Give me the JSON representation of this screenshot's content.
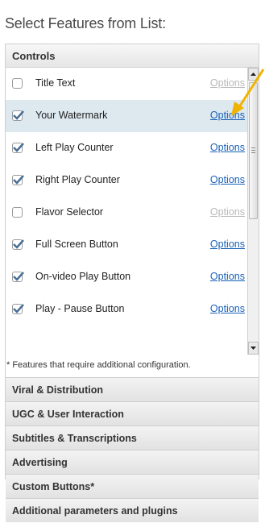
{
  "page_title": "Select Features from List:",
  "section_title": "Controls",
  "features": [
    {
      "label": "Title Text",
      "checked": false,
      "option": "Options",
      "option_enabled": false
    },
    {
      "label": "Your Watermark",
      "checked": true,
      "option": "Options",
      "option_enabled": true
    },
    {
      "label": "Left Play Counter",
      "checked": true,
      "option": "Options",
      "option_enabled": true
    },
    {
      "label": "Right Play Counter",
      "checked": true,
      "option": "Options",
      "option_enabled": true
    },
    {
      "label": "Flavor Selector",
      "checked": false,
      "option": "Options",
      "option_enabled": false
    },
    {
      "label": "Full Screen Button",
      "checked": true,
      "option": "Options",
      "option_enabled": true
    },
    {
      "label": "On-video Play Button",
      "checked": true,
      "option": "Options",
      "option_enabled": true
    },
    {
      "label": "Play - Pause Button",
      "checked": true,
      "option": "Options",
      "option_enabled": true
    }
  ],
  "footnote": "* Features that require additional configuration.",
  "categories": [
    "Viral & Distribution",
    "UGC & User Interaction",
    "Subtitles & Transcriptions",
    "Advertising",
    "Custom Buttons*",
    "Additional parameters and plugins"
  ],
  "colors": {
    "link": "#1a62b8",
    "highlight_row": "#dde8ef",
    "arrow": "#f0b400"
  }
}
